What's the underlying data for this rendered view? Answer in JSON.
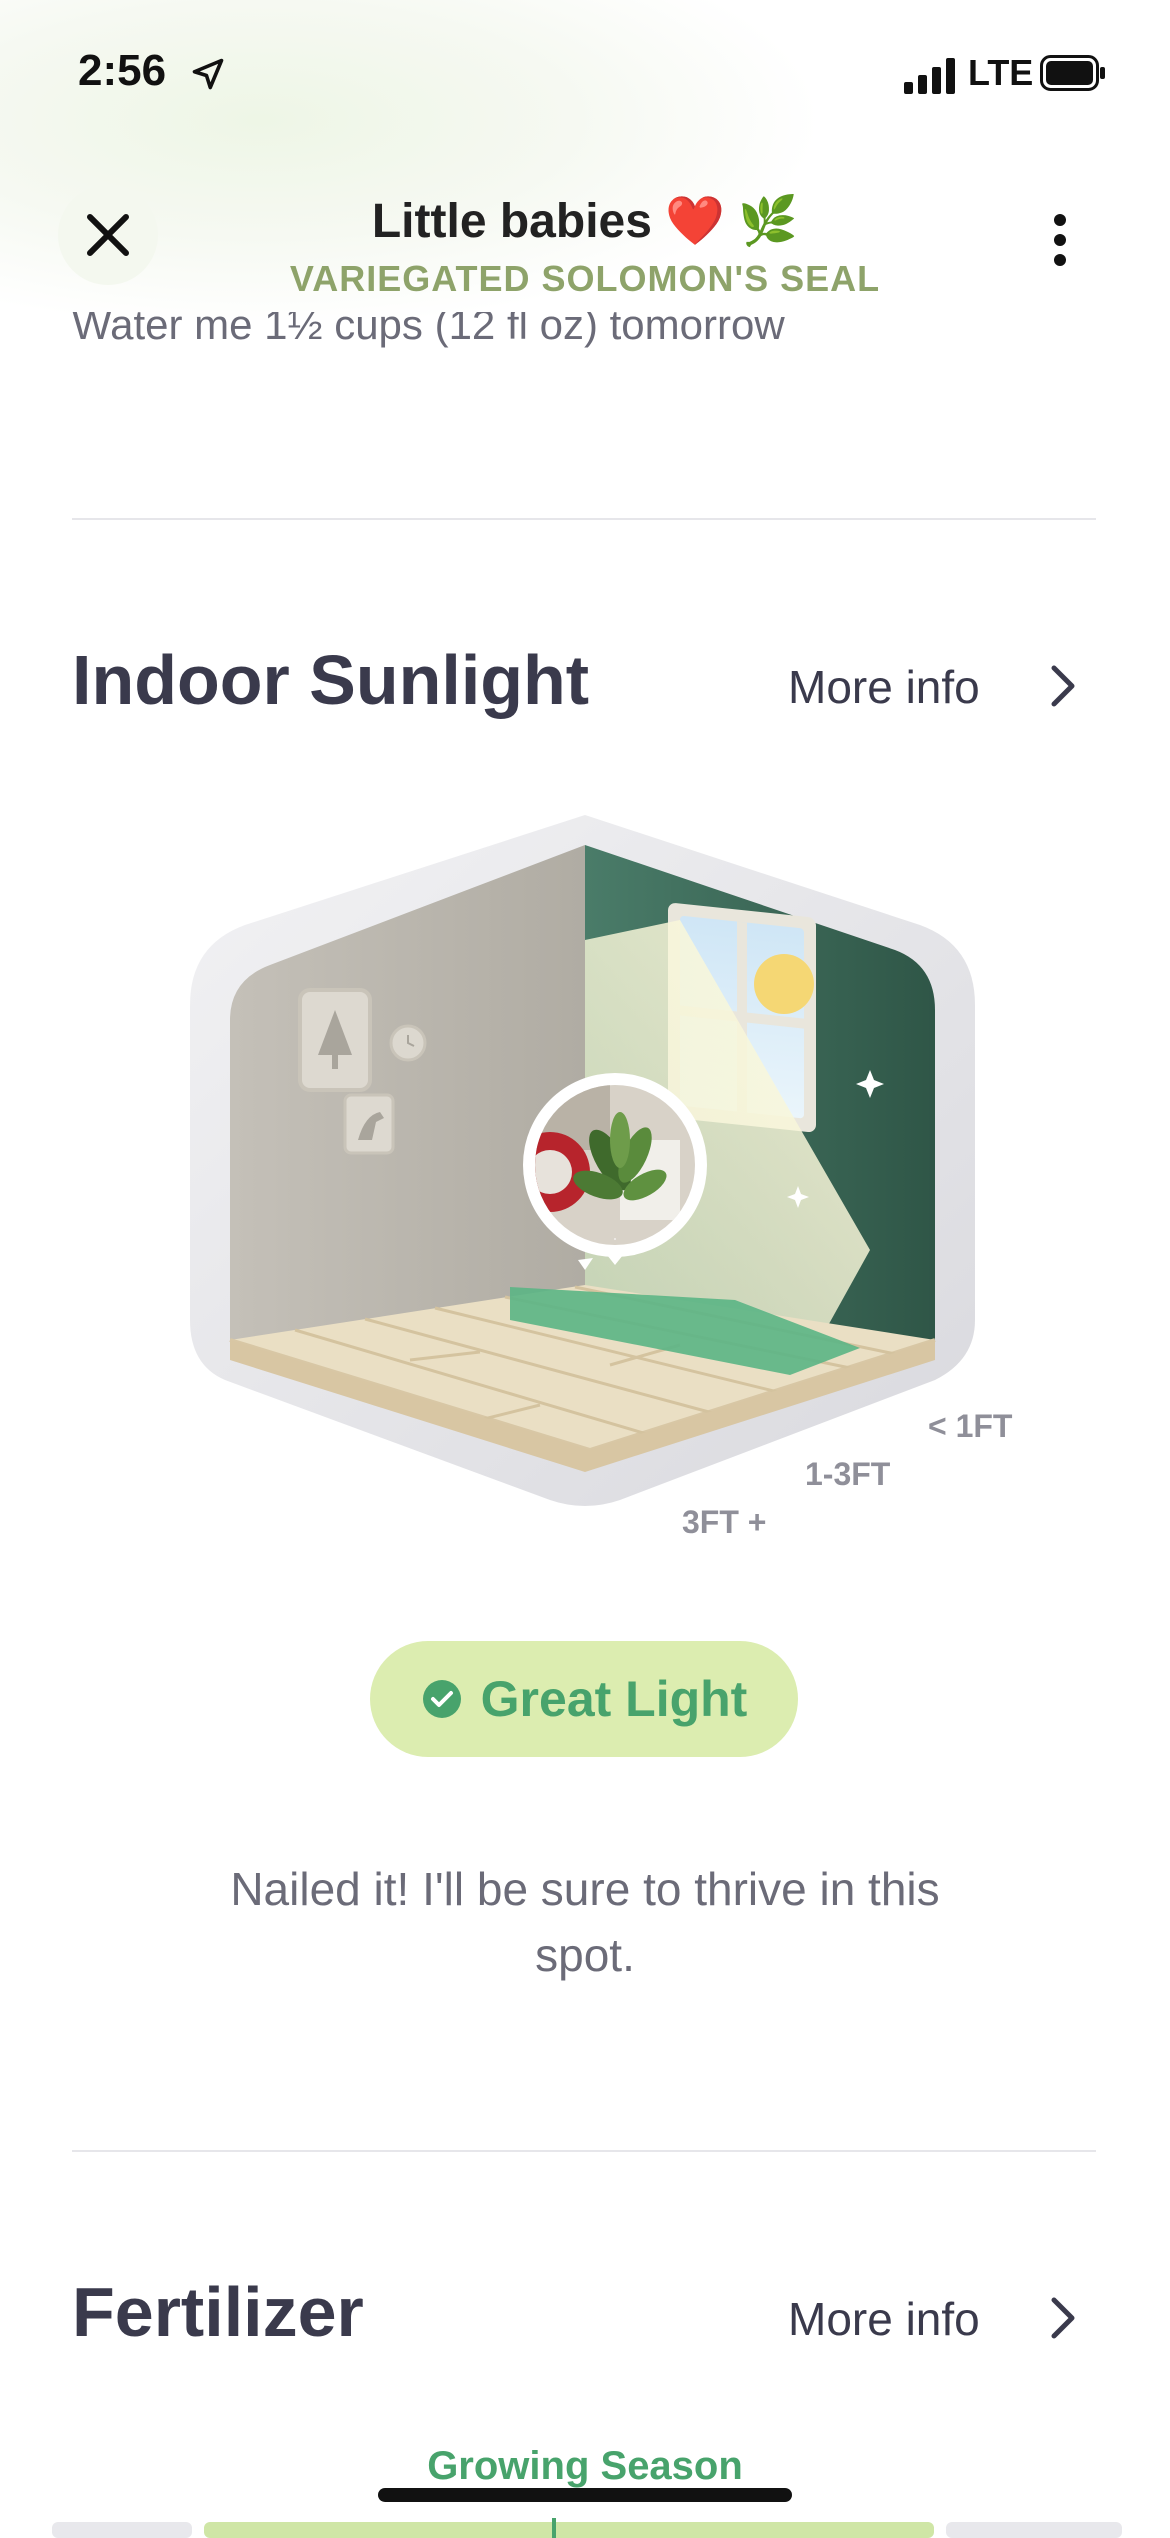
{
  "status_bar": {
    "time": "2:56",
    "network": "LTE"
  },
  "header": {
    "title": "Little babies ❤️ 🌿",
    "subtitle": "VARIEGATED SOLOMON'S SEAL"
  },
  "water": {
    "text": "Water me 1½ cups (12 fl oz) tomorrow"
  },
  "sunlight": {
    "title": "Indoor Sunlight",
    "more_info": "More info",
    "distances": [
      "< 1FT",
      "1-3FT",
      "3FT +"
    ],
    "status": "Great Light",
    "description": "Nailed it! I'll be sure to thrive in this spot."
  },
  "fertilizer": {
    "title": "Fertilizer",
    "more_info": "More info",
    "season_label": "Growing Season"
  },
  "colors": {
    "accent_green": "#48a36c",
    "pill_bg": "#dcedb0",
    "subtitle_green": "#8ea36a",
    "wall_green": "#3f6f5e"
  }
}
